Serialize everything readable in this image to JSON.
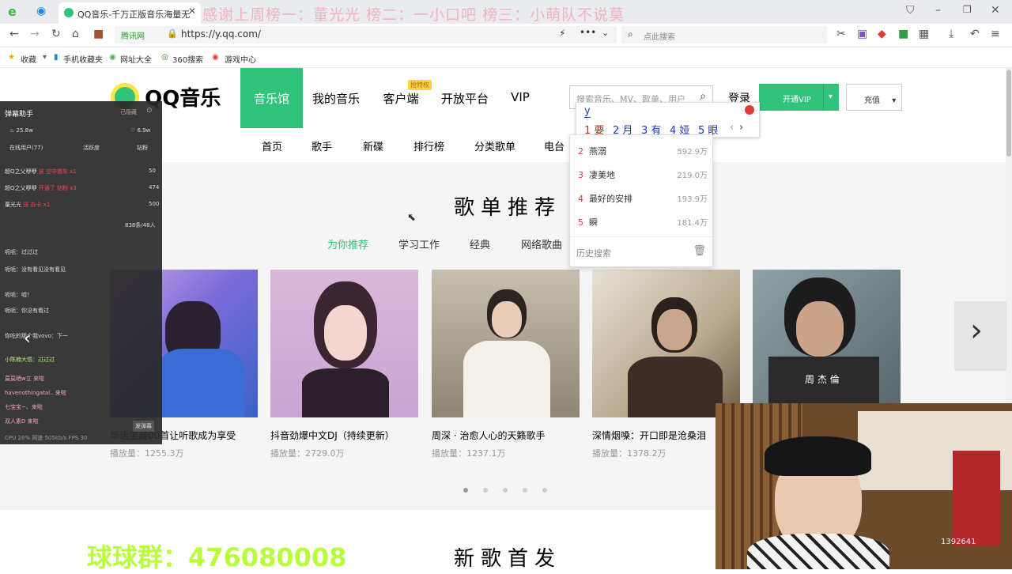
{
  "browser": {
    "tab_title": "QQ音乐-千万正版音乐海量无",
    "url_prefix": "腾讯网",
    "url": "https://y.qq.com/",
    "search_placeholder": "点此搜索",
    "bookmarks": [
      "收藏",
      "手机收藏夹",
      "网址大全",
      "360搜索",
      "游戏中心"
    ],
    "accent": "#31c27c"
  },
  "marquee": "感谢上周榜一：董光光  榜二：一小口吧  榜三：小萌队不说莫",
  "site": {
    "logo_text": "QQ音乐",
    "nav": [
      "音乐馆",
      "我的音乐",
      "客户端",
      "开放平台",
      "VIP"
    ],
    "nav_badge": "抢特权",
    "search_placeholder": "搜索音乐、MV、歌单、用户",
    "login": "登录",
    "vip_button": "开通VIP",
    "charge_button": "充值",
    "subnav": [
      "首页",
      "歌手",
      "新碟",
      "排行榜",
      "分类歌单",
      "电台"
    ],
    "section_title": "歌单推荐",
    "categories": [
      "为你推荐",
      "学习工作",
      "经典",
      "网络歌曲"
    ],
    "playlists": [
      {
        "name": "华语宝藏00首让听歌成为享受",
        "plays": "播放量：1255.3万"
      },
      {
        "name": "抖音劲爆中文DJ（持续更新）",
        "plays": "播放量：2729.0万"
      },
      {
        "name": "周深 · 治愈人心的天籁歌手",
        "plays": "播放量：1237.1万"
      },
      {
        "name": "深情烟嗓：开口即是沧桑泪",
        "plays": "播放量：1378.2万"
      },
      {
        "name": "",
        "plays": ""
      }
    ],
    "cover_text": "周 杰 倫",
    "next_section": "新歌首发"
  },
  "ime": {
    "input": "y",
    "candidates": [
      "1 要",
      "2 月",
      "3 有",
      "4 娅",
      "5 眼"
    ]
  },
  "suggestions": [
    {
      "rank": "2",
      "text": "燕溺",
      "count": "592.9万"
    },
    {
      "rank": "3",
      "text": "凄美地",
      "count": "219.0万"
    },
    {
      "rank": "4",
      "text": "最好的安排",
      "count": "193.9万"
    },
    {
      "rank": "5",
      "text": "瞬",
      "count": "181.4万"
    }
  ],
  "history_label": "历史搜索",
  "danmaku": {
    "title": "弹幕助手",
    "status": "已隐藏",
    "stats": [
      "25.8w",
      "6.9w"
    ],
    "tabs": [
      "在线用户(77)",
      "活跃度",
      "钻粉"
    ],
    "gifts": [
      {
        "user": "超Q之父咿咿",
        "gift": "送 空中霸车 x1",
        "count": "50"
      },
      {
        "user": "超Q之父咿咿",
        "gift": "开通了 钻粉 x3",
        "count": "474"
      },
      {
        "user": "董光光",
        "gift": "送 办卡 x1",
        "count": "500"
      }
    ],
    "viewers": "838条/48人",
    "messages": [
      "呃呃：过过过",
      "呃呃：没有看见没有看见",
      "呃呃：嘘！",
      "呃呃：你没有看过",
      "你吃的那个我vovo：下一",
      "小陈楠大悟：过过过"
    ],
    "enters": [
      "莫莫晒w立 来啦",
      "havenothingatal.. 来啦",
      "七宝宝~、来啦",
      "双人素D 来啦"
    ],
    "footer": "CPU 28%  网速 505kb/s  FPS 30",
    "send": "发弹幕"
  },
  "qgroup": "球球群：476080008",
  "watermark": "1392641"
}
